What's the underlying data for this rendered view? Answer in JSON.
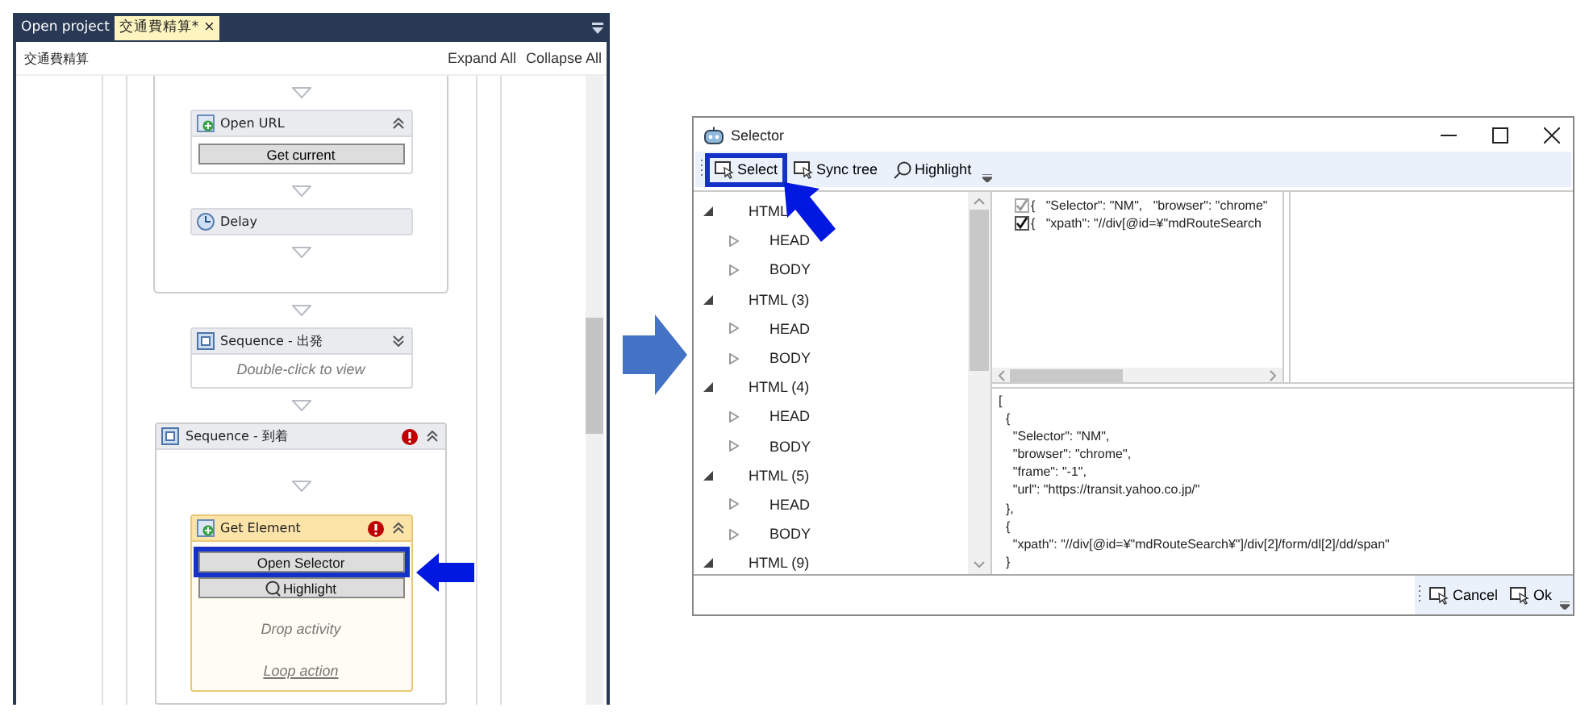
{
  "designer": {
    "tabs": [
      {
        "label": "Open project",
        "selected": false
      },
      {
        "label": "交通費精算*",
        "selected": true,
        "close": "×"
      }
    ],
    "title": "交通費精算",
    "actions": [
      "Expand All",
      "Collapse All"
    ],
    "container": {
      "activities": [
        {
          "kind": "open_url",
          "title": "Open URL",
          "button": "Get current"
        },
        {
          "kind": "delay",
          "title": "Delay"
        }
      ]
    },
    "sequences": [
      {
        "title": "Sequence - 出発",
        "expanded": false,
        "error": false,
        "hint": "Double-click to view"
      },
      {
        "title": "Sequence - 到着",
        "expanded": true,
        "error": true,
        "child": {
          "title": "Get Element",
          "error": true,
          "buttons": [
            "Open Selector",
            "Highlight"
          ],
          "drop": "Drop activity",
          "link": "Loop action"
        }
      }
    ]
  },
  "selector": {
    "title": "Selector",
    "toolbar": [
      {
        "label": "Select",
        "kind": "pointer"
      },
      {
        "label": "Sync tree",
        "kind": "pointer"
      },
      {
        "label": "Highlight",
        "kind": "search"
      }
    ],
    "tree": [
      {
        "label": "HTML",
        "expanded": true,
        "children": [
          {
            "label": "HEAD",
            "expanded": false
          },
          {
            "label": "BODY",
            "expanded": false
          }
        ]
      },
      {
        "label": "HTML (3)",
        "expanded": true,
        "children": [
          {
            "label": "HEAD",
            "expanded": false
          },
          {
            "label": "BODY",
            "expanded": false
          }
        ]
      },
      {
        "label": "HTML (4)",
        "expanded": true,
        "children": [
          {
            "label": "HEAD",
            "expanded": false
          },
          {
            "label": "BODY",
            "expanded": false
          }
        ]
      },
      {
        "label": "HTML (5)",
        "expanded": true,
        "children": [
          {
            "label": "HEAD",
            "expanded": false
          },
          {
            "label": "BODY",
            "expanded": false
          }
        ]
      },
      {
        "label": "HTML (9)",
        "expanded": true
      }
    ],
    "parts": [
      {
        "text": "{   \"Selector\": \"NM\",   \"browser\": \"chrome\"",
        "checked": true,
        "disabled": true
      },
      {
        "text": "{   \"xpath\": \"//div[@id=¥\"mdRouteSearch",
        "checked": true,
        "disabled": false
      }
    ],
    "json_lines": [
      "[",
      "  {",
      "    \"Selector\": \"NM\",",
      "    \"browser\": \"chrome\",",
      "    \"frame\": \"-1\",",
      "    \"url\": \"https://transit.yahoo.co.jp/\"",
      "  },",
      "  {",
      "    \"xpath\": \"//div[@id=¥\"mdRouteSearch¥\"]/div[2]/form/dl[2]/dd/span\"",
      "  }"
    ],
    "footer": [
      "Cancel",
      "Ok"
    ]
  }
}
